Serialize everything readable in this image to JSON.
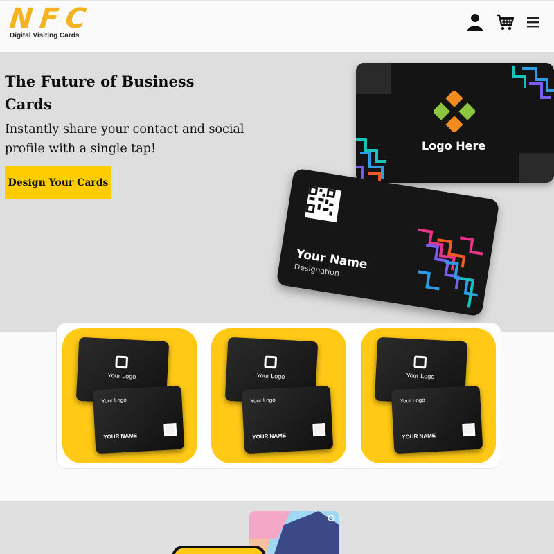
{
  "header": {
    "logo_text": "NFC",
    "logo_subtitle": "Digital Visiting Cards",
    "brand_color": "#f5b41f",
    "icons": [
      "user-icon",
      "cart-icon",
      "menu-icon"
    ]
  },
  "hero": {
    "title": "The Future of Business Cards",
    "description": "Instantly share your contact and social profile with a single tap!",
    "cta_label": "Design Your Cards",
    "cta_color": "#ffcc00",
    "front_card": {
      "name": "Your Name",
      "designation": "Designation"
    },
    "back_card": {
      "logo_text": "Logo Here"
    }
  },
  "products": {
    "tile_color": "#ffc915",
    "items": [
      {
        "back_logo": "Your Logo",
        "front_logo": "Your Logo",
        "name": "YOUR NAME"
      },
      {
        "back_logo": "Your Logo",
        "front_logo": "Your Logo",
        "name": "YOUR NAME"
      },
      {
        "back_logo": "Your Logo",
        "front_logo": "Your Logo",
        "name": "YOUR NAME"
      }
    ]
  }
}
